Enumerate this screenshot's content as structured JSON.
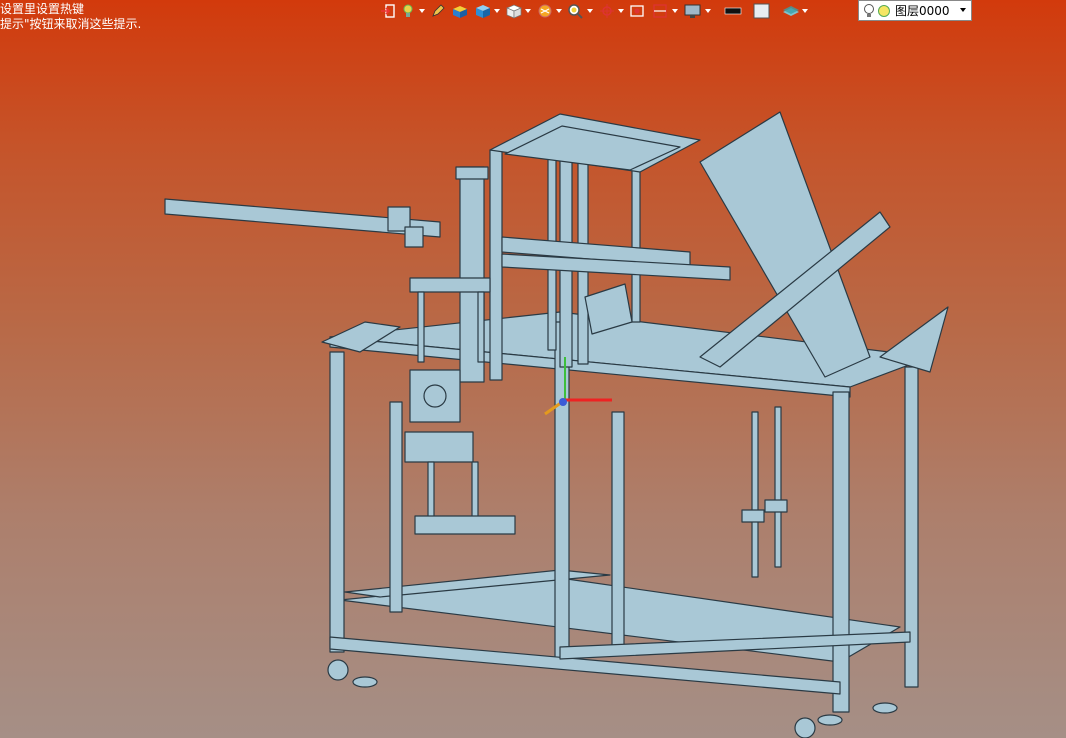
{
  "hints": {
    "line1": "设置里设置热键",
    "line2": "提示\"按钮来取消这些提示."
  },
  "toolbar": {
    "items": [
      {
        "icon": "exit-icon"
      },
      {
        "icon": "light-bulb-dropdown-icon"
      },
      {
        "icon": "pencil-icon"
      },
      {
        "icon": "material-box-icon"
      },
      {
        "icon": "shaded-cube-dropdown-icon"
      },
      {
        "icon": "wire-cube-dropdown-icon"
      },
      {
        "icon": "render-dropdown-icon"
      },
      {
        "icon": "zoom-dropdown-icon"
      },
      {
        "icon": "pan-dropdown-icon"
      },
      {
        "icon": "zoom-box-icon"
      },
      {
        "icon": "section-dropdown-icon"
      },
      {
        "icon": "display-monitor-dropdown-icon"
      },
      {
        "icon": "black-swatch-icon"
      },
      {
        "icon": "white-swatch-icon"
      },
      {
        "icon": "layer-dropdown-icon"
      }
    ],
    "layer": {
      "name": "图层0000",
      "bulb_color": "#f5e663"
    }
  },
  "scene": {
    "model": "machine-frame-3d-model",
    "model_color": "#a9c8d6",
    "edge_color": "#2a3a44"
  }
}
